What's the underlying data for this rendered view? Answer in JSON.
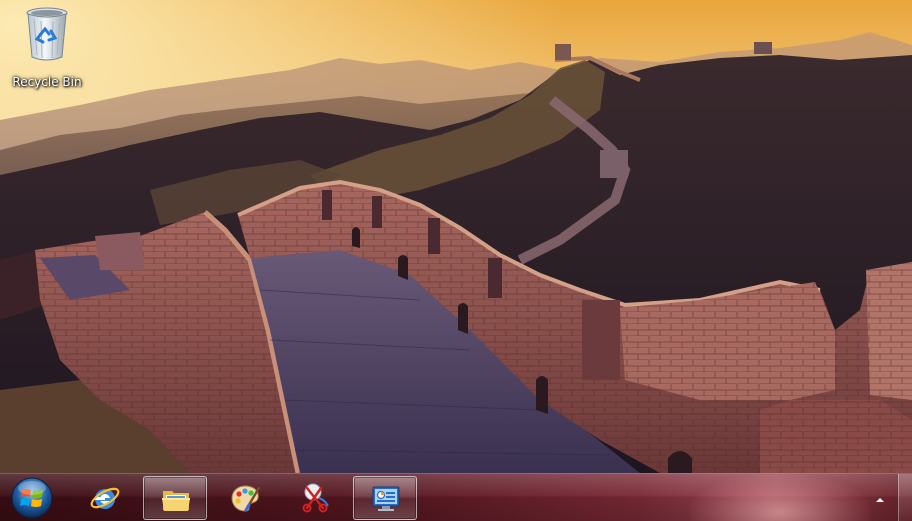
{
  "desktop": {
    "icons": [
      {
        "label": "Recycle Bin",
        "icon": "recycle-bin-icon"
      }
    ]
  },
  "taskbar": {
    "start_icon": "windows-orb-icon",
    "buttons": [
      {
        "icon": "internet-explorer-icon",
        "active": false
      },
      {
        "icon": "windows-explorer-folder-icon",
        "active": true
      },
      {
        "icon": "paint-palette-icon",
        "active": false
      },
      {
        "icon": "snipping-tool-icon",
        "active": false
      },
      {
        "icon": "control-panel-icon",
        "active": true
      }
    ],
    "tray_icon": "show-hidden-icons-chevron-icon"
  },
  "colors": {
    "taskbar_base": "#5a1822",
    "sky_top": "#f2b64a",
    "sky_haze": "#f6d89a",
    "wall_brick": "#8a5048"
  }
}
